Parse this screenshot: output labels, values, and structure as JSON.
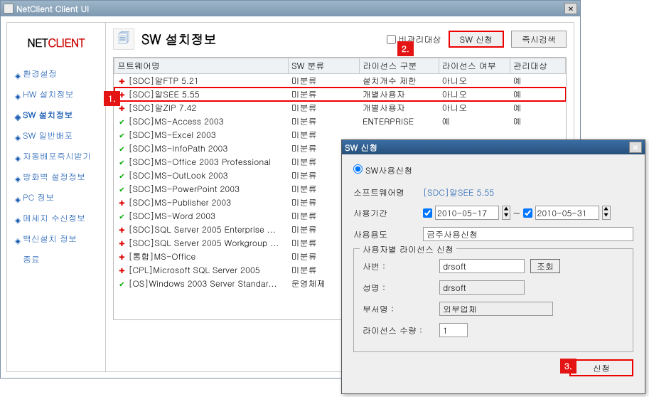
{
  "window": {
    "title": "NetClient Client UI"
  },
  "logo": {
    "brand_pre": "NET",
    "brand_accent": "CLIENT",
    "tagline": ""
  },
  "sidebar": {
    "items": [
      {
        "label": "환경설정"
      },
      {
        "label": "HW 설치정보"
      },
      {
        "label": "SW 설치정보"
      },
      {
        "label": "SW 일반배포"
      },
      {
        "label": "자동배포즉시받기"
      },
      {
        "label": "방화벽 설정정보"
      },
      {
        "label": "PC 정보"
      },
      {
        "label": "메세지 수신정보"
      },
      {
        "label": "백신설치 정보"
      },
      {
        "label": "종료"
      }
    ]
  },
  "header": {
    "title": "SW 설치정보",
    "chk_label": "비관리대상",
    "btn_request": "SW 신청",
    "btn_scan": "즉시검색"
  },
  "table": {
    "cols": [
      "프트웨어명",
      "SW 분류",
      "라이선스 구분",
      "라이선스 여부",
      "관리대상"
    ],
    "rows": [
      {
        "icon": "red",
        "name": "[SDC]알FTP 5.21",
        "cat": "미분류",
        "lic": "설치개수 제한",
        "has": "아니오",
        "mgd": "예"
      },
      {
        "icon": "red",
        "name": "[SDC]알SEE 5.55",
        "cat": "미분류",
        "lic": "개별사용자",
        "has": "아니오",
        "mgd": "예",
        "highlight": true
      },
      {
        "icon": "red",
        "name": "[SDC]알ZIP 7.42",
        "cat": "미분류",
        "lic": "개별사용자",
        "has": "아니오",
        "mgd": "예"
      },
      {
        "icon": "green",
        "name": "[SDC]MS-Access 2003",
        "cat": "미분류",
        "lic": "ENTERPRISE",
        "has": "예",
        "mgd": "예"
      },
      {
        "icon": "green",
        "name": "[SDC]MS-Excel 2003",
        "cat": "미분류",
        "lic": "",
        "has": "",
        "mgd": ""
      },
      {
        "icon": "green",
        "name": "[SDC]MS-InfoPath 2003",
        "cat": "미분류",
        "lic": "",
        "has": "",
        "mgd": ""
      },
      {
        "icon": "green",
        "name": "[SDC]MS-Office 2003 Professional",
        "cat": "미분류",
        "lic": "",
        "has": "",
        "mgd": ""
      },
      {
        "icon": "green",
        "name": "[SDC]MS-OutLook 2003",
        "cat": "미분류",
        "lic": "",
        "has": "",
        "mgd": ""
      },
      {
        "icon": "green",
        "name": "[SDC]MS-PowerPoint 2003",
        "cat": "미분류",
        "lic": "",
        "has": "",
        "mgd": ""
      },
      {
        "icon": "red",
        "name": "[SDC]MS-Publisher 2003",
        "cat": "미분류",
        "lic": "",
        "has": "",
        "mgd": ""
      },
      {
        "icon": "green",
        "name": "[SDC]MS-Word 2003",
        "cat": "미분류",
        "lic": "",
        "has": "",
        "mgd": ""
      },
      {
        "icon": "red",
        "name": "[SDC]SQL Server 2005 Enterprise ...",
        "cat": "미분류",
        "lic": "",
        "has": "",
        "mgd": ""
      },
      {
        "icon": "red",
        "name": "[SDC]SQL Server 2005 Workgroup ...",
        "cat": "미분류",
        "lic": "",
        "has": "",
        "mgd": ""
      },
      {
        "icon": "red",
        "name": "[통합]MS-Office",
        "cat": "미분류",
        "lic": "",
        "has": "",
        "mgd": ""
      },
      {
        "icon": "red",
        "name": "[CPL]Microsoft SQL Server 2005",
        "cat": "미분류",
        "lic": "",
        "has": "",
        "mgd": ""
      },
      {
        "icon": "green",
        "name": "[OS]Windows 2003 Server Standar...",
        "cat": "운영체제",
        "lic": "",
        "has": "",
        "mgd": ""
      }
    ]
  },
  "callouts": {
    "c1": "1.",
    "c2": "2.",
    "c3": "3."
  },
  "dialog": {
    "title": "SW 신청",
    "radio_label": "SW사용신청",
    "lbl_swname": "소프트웨어명",
    "val_swname": "[SDC]알SEE 5.55",
    "lbl_period": "사용기간",
    "date_from": "2010-05-17",
    "date_to": "2010-05-31",
    "date_sep": "~",
    "lbl_usage": "사용용도",
    "val_usage": "금주사용신청",
    "fieldset_title": "사용자별 라이선스 신청",
    "lbl_sabun": "사번 :",
    "val_sabun": "drsoft",
    "btn_lookup": "조회",
    "lbl_name": "성명 :",
    "val_name": "drsoft",
    "lbl_dept": "부서명 :",
    "val_dept": "외부업체",
    "lbl_qty": "라이선스 수량 :",
    "val_qty": "1",
    "btn_submit": "신청"
  }
}
